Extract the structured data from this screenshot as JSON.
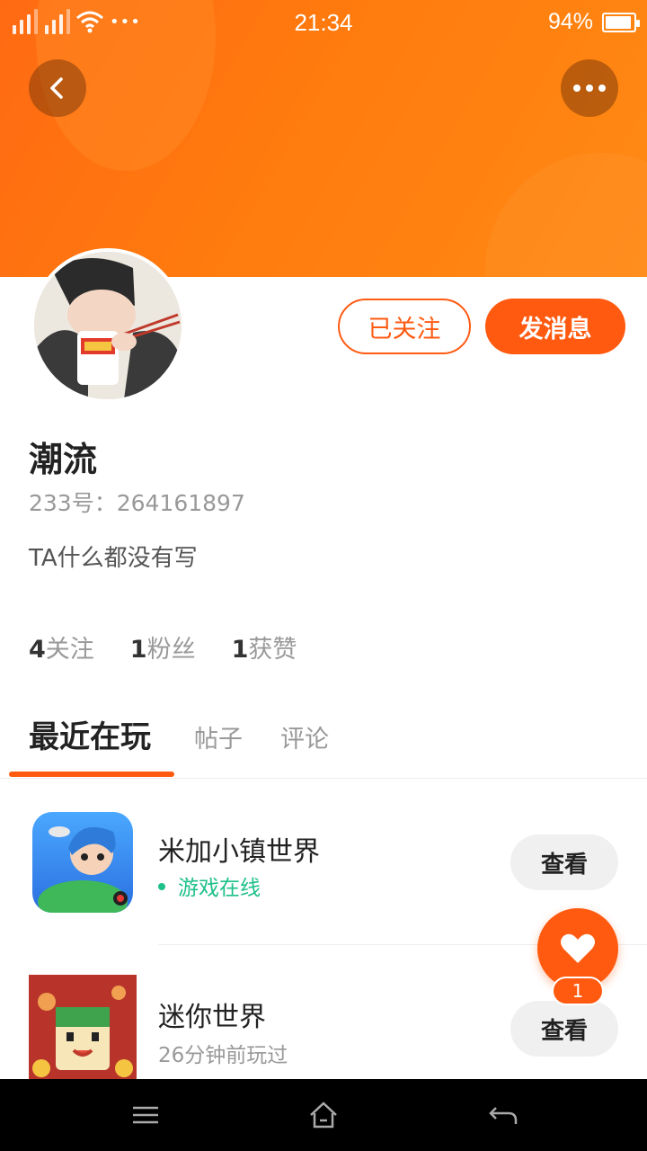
{
  "status_bar": {
    "time": "21:34",
    "battery_text": "94%",
    "battery_level": 0.94,
    "more_dots": "•••"
  },
  "colors": {
    "brand_orange": "#ff5a0f",
    "header_gradient": [
      "#ff6a13",
      "#ff8a14"
    ],
    "online_green": "#1ec08a"
  },
  "header": {
    "back_icon": "chevron-left-icon",
    "more_icon": "more-dots-icon"
  },
  "profile": {
    "name": "潮流",
    "uid": "233号：264161897",
    "bio": "TA什么都没有写",
    "follow_label": "已关注",
    "message_label": "发消息",
    "stats": [
      {
        "count": "4",
        "label": "关注"
      },
      {
        "count": "1",
        "label": "粉丝"
      },
      {
        "count": "1",
        "label": "获赞"
      }
    ]
  },
  "tabs": [
    {
      "label": "最近在玩",
      "active": true
    },
    {
      "label": "帖子",
      "active": false
    },
    {
      "label": "评论",
      "active": false
    }
  ],
  "games": [
    {
      "title": "米加小镇世界",
      "subtitle": "游戏在线",
      "online": true,
      "button": "查看"
    },
    {
      "title": "迷你世界",
      "subtitle": "26分钟前玩过",
      "online": false,
      "button": "查看"
    }
  ],
  "like_fab": {
    "count": "1",
    "icon": "heart-icon"
  },
  "nav_bar": {
    "icons": [
      "menu-icon",
      "home-icon",
      "back-arrow-icon"
    ]
  }
}
